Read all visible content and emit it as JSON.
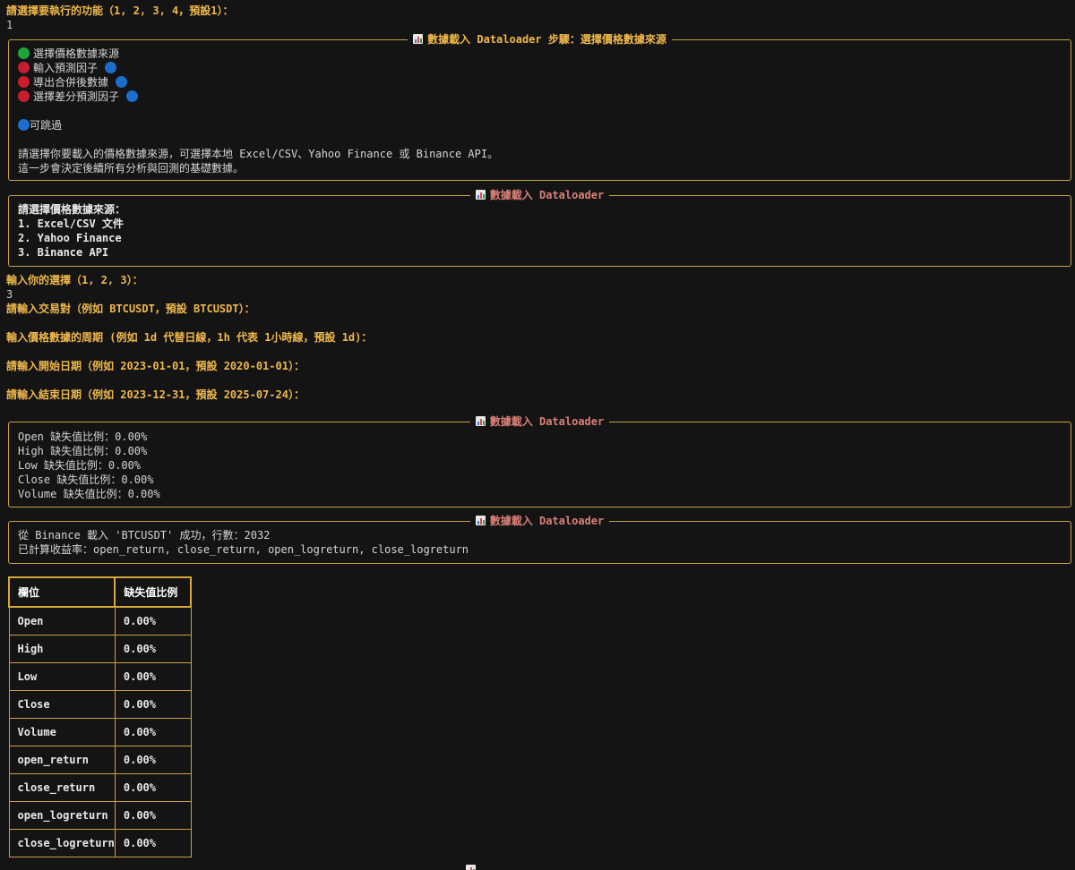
{
  "prompts": {
    "function_choice": "請選擇要執行的功能（1, 2, 3, 4，預設1）：",
    "function_input": "1",
    "source_choice": "輸入你的選擇（1, 2, 3）：",
    "source_input": "3",
    "symbol": "請輸入交易對（例如 BTCUSDT，預設 BTCUSDT）：",
    "interval": "輸入價格數據的周期 (例如 1d 代替日線，1h 代表 1小時線，預設 1d)：",
    "start_date": "請輸入開始日期（例如 2023-01-01，預設 2020-01-01）：",
    "end_date": "請輸入結束日期（例如 2023-12-31，預設 2025-07-24）："
  },
  "step_panel": {
    "title": "數據載入 Dataloader 步驟：選擇價格數據來源",
    "steps": [
      {
        "label": "選擇價格數據來源",
        "status": "green",
        "skippable": false
      },
      {
        "label": "輸入預測因子",
        "status": "red",
        "skippable": true
      },
      {
        "label": "導出合併後數據",
        "status": "red",
        "skippable": true
      },
      {
        "label": "選擇差分預測因子",
        "status": "red",
        "skippable": true
      }
    ],
    "skip_note": "可跳過",
    "desc_line1": "請選擇你要載入的價格數據來源，可選擇本地 Excel/CSV、Yahoo Finance 或 Binance API。",
    "desc_line2": "這一步會決定後續所有分析與回測的基礎數據。"
  },
  "source_panel": {
    "title": "數據載入 Dataloader",
    "heading": "請選擇價格數據來源：",
    "options": [
      "1. Excel/CSV 文件",
      "2. Yahoo Finance",
      "3. Binance API"
    ]
  },
  "missing_panel": {
    "title": "數據載入 Dataloader",
    "lines": [
      "Open 缺失值比例：0.00%",
      "High 缺失值比例：0.00%",
      "Low 缺失值比例：0.00%",
      "Close 缺失值比例：0.00%",
      "Volume 缺失值比例：0.00%"
    ]
  },
  "load_panel": {
    "title": "數據載入 Dataloader",
    "line1": "從 Binance 載入 'BTCUSDT' 成功，行數：2032",
    "line2": "已計算收益率：open_return, close_return, open_logreturn, close_logreturn"
  },
  "table": {
    "headers": [
      "欄位",
      "缺失值比例"
    ],
    "rows": [
      [
        "Open",
        "0.00%"
      ],
      [
        "High",
        "0.00%"
      ],
      [
        "Low",
        "0.00%"
      ],
      [
        "Close",
        "0.00%"
      ],
      [
        "Volume",
        "0.00%"
      ],
      [
        "open_return",
        "0.00%"
      ],
      [
        "close_return",
        "0.00%"
      ],
      [
        "open_logreturn",
        "0.00%"
      ],
      [
        "close_logreturn",
        "0.00%"
      ]
    ]
  },
  "colors": {
    "prompt": "#f0b84a",
    "panel_border": "#c9a044",
    "title_pink": "#d98078",
    "status_green": "#1fa33c",
    "status_red": "#c81d2e",
    "skip_blue": "#1c6ecd"
  }
}
